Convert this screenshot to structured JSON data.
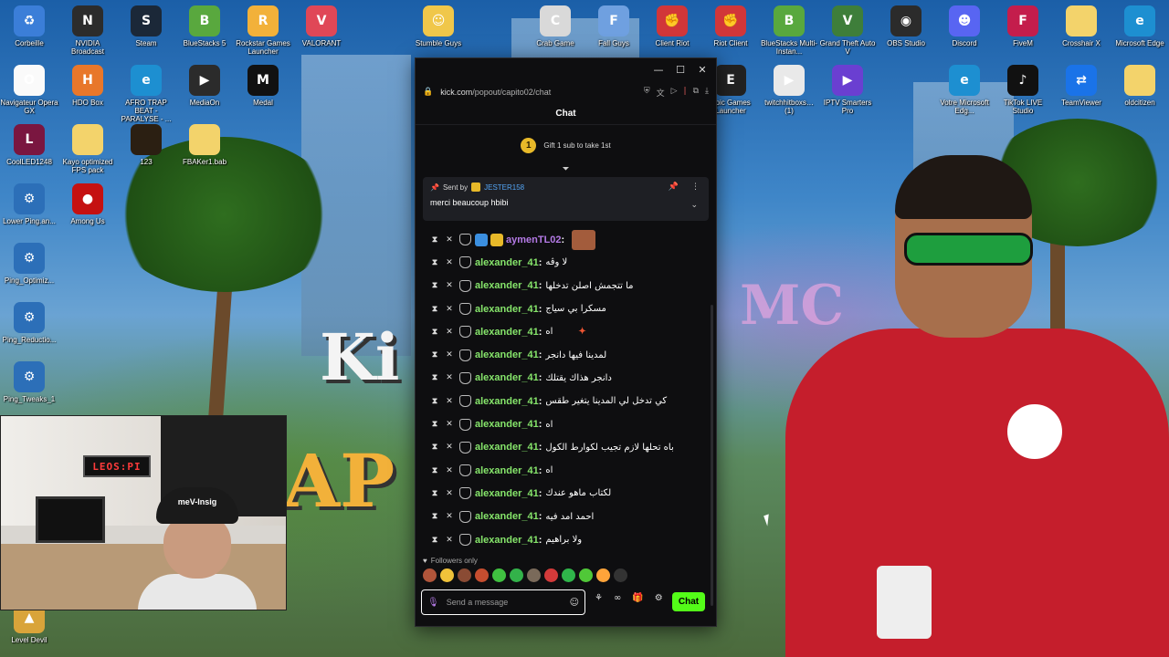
{
  "desktop": {
    "icons": [
      {
        "label": "Corbeille",
        "icon": "recycle-bin-icon",
        "color": "#3b7ed8",
        "glyph": "♻"
      },
      {
        "label": "NVIDIA Broadcast",
        "icon": "nvidia-broadcast-icon",
        "color": "#2c2c2c",
        "glyph": "N"
      },
      {
        "label": "Steam",
        "icon": "steam-icon",
        "color": "#1b2838",
        "glyph": "S"
      },
      {
        "label": "BlueStacks 5",
        "icon": "bluestacks-icon",
        "color": "#59a83e",
        "glyph": "B"
      },
      {
        "label": "Rockstar Games Launcher",
        "icon": "rockstar-icon",
        "color": "#f2b13a",
        "glyph": "R"
      },
      {
        "label": "VALORANT",
        "icon": "valorant-icon",
        "color": "#e04757",
        "glyph": "V"
      },
      {
        "label": "Stumble Guys",
        "icon": "stumble-guys-icon",
        "color": "#f0c74a",
        "glyph": "☺"
      },
      {
        "label": "Crab Game",
        "icon": "crab-game-icon",
        "color": "#d9d9d9",
        "glyph": "C"
      },
      {
        "label": "Fall Guys",
        "icon": "fall-guys-icon",
        "color": "#6fa0e0",
        "glyph": "F"
      },
      {
        "label": "Client Riot",
        "icon": "riot-client-icon",
        "color": "#d13639",
        "glyph": "✊"
      },
      {
        "label": "Riot Client",
        "icon": "riot-client-icon",
        "color": "#d13639",
        "glyph": "✊"
      },
      {
        "label": "BlueStacks Multi-Instan...",
        "icon": "bluestacks-multi-icon",
        "color": "#59a83e",
        "glyph": "B"
      },
      {
        "label": "Grand Theft Auto V",
        "icon": "gta-icon",
        "color": "#3e7e3a",
        "glyph": "V"
      },
      {
        "label": "OBS Studio",
        "icon": "obs-icon",
        "color": "#2b2b2b",
        "glyph": "◉"
      },
      {
        "label": "Discord",
        "icon": "discord-icon",
        "color": "#5865f2",
        "glyph": "☻"
      },
      {
        "label": "FiveM",
        "icon": "fivem-icon",
        "color": "#c41d4c",
        "glyph": "F"
      },
      {
        "label": "Crosshair X",
        "icon": "folder-icon",
        "color": "#f3d36b",
        "glyph": ""
      },
      {
        "label": "Microsoft Edge",
        "icon": "edge-icon",
        "color": "#1d8fd1",
        "glyph": "e"
      },
      {
        "label": "Navigateur Opera GX",
        "icon": "opera-icon",
        "color": "#fafafa",
        "glyph": "O"
      },
      {
        "label": "HDO Box",
        "icon": "hdo-box-icon",
        "color": "#e8772a",
        "glyph": "H"
      },
      {
        "label": "AFRO TRAP BEAT - PARALYSE - ...",
        "icon": "edge-icon",
        "color": "#1d8fd1",
        "glyph": "e"
      },
      {
        "label": "MediaOn",
        "icon": "media-icon",
        "color": "#2b2b2b",
        "glyph": "▶"
      },
      {
        "label": "Medal",
        "icon": "medal-icon",
        "color": "#111111",
        "glyph": "M"
      },
      {
        "label": "Epic Games Launcher",
        "icon": "epic-games-icon",
        "color": "#222222",
        "glyph": "E"
      },
      {
        "label": "twitchhitboxs… (1)",
        "icon": "video-file-icon",
        "color": "#e9e9e9",
        "glyph": "▶"
      },
      {
        "label": "IPTV Smarters Pro",
        "icon": "iptv-icon",
        "color": "#6a3fd1",
        "glyph": "▶"
      },
      {
        "label": "Votre Microsoft Edg...",
        "icon": "edge-icon",
        "color": "#1d8fd1",
        "glyph": "e"
      },
      {
        "label": "TikTok LIVE Studio",
        "icon": "tiktok-icon",
        "color": "#111111",
        "glyph": "♪"
      },
      {
        "label": "TeamViewer",
        "icon": "teamviewer-icon",
        "color": "#1a73e8",
        "glyph": "⇄"
      },
      {
        "label": "oldcitizen",
        "icon": "folder-icon",
        "color": "#f3d36b",
        "glyph": ""
      },
      {
        "label": "CoolLED1248",
        "icon": "coolled-icon",
        "color": "#7a1640",
        "glyph": "L"
      },
      {
        "label": "Kayo optimized FPS pack",
        "icon": "folder-icon",
        "color": "#f3d36b",
        "glyph": ""
      },
      {
        "label": "123",
        "icon": "folder-dark-icon",
        "color": "#2b1f12",
        "glyph": ""
      },
      {
        "label": "FBAKer1.bab",
        "icon": "folder-icon",
        "color": "#f3d36b",
        "glyph": ""
      },
      {
        "label": "Lower Ping.an...",
        "icon": "script-file-icon",
        "color": "#2c6fb8",
        "glyph": "⚙"
      },
      {
        "label": "Among Us",
        "icon": "among-us-icon",
        "color": "#c51111",
        "glyph": "●"
      },
      {
        "label": "Ping_Optimiz...",
        "icon": "script-file-icon",
        "color": "#2c6fb8",
        "glyph": "⚙"
      },
      {
        "label": "Ping_Reductio...",
        "icon": "script-file-icon",
        "color": "#2c6fb8",
        "glyph": "⚙"
      },
      {
        "label": "Ping_Tweaks_1",
        "icon": "script-file-icon",
        "color": "#2c6fb8",
        "glyph": "⚙"
      },
      {
        "label": "Level Devil",
        "icon": "level-devil-icon",
        "color": "#d9a43a",
        "glyph": "▲"
      }
    ],
    "bg_text_1": "Ki",
    "bg_text_2": "AP",
    "bg_text_3": "MC"
  },
  "webcam": {
    "led_text": "LEOS:PI",
    "cap_text": "meV-Insig"
  },
  "window": {
    "url_domain": "kick.com",
    "url_path": "/popout/capito02/chat",
    "chat_title": "Chat",
    "gift_count": "1",
    "gift_text": "Gift 1 sub to take 1st",
    "pinned": {
      "sent_by_label": "Sent by",
      "sender": "JESTER158",
      "message": "merci beaucoup hbibi"
    },
    "messages": [
      {
        "user": "aymenTL02",
        "text": "",
        "style": "purple",
        "extra": "avatar"
      },
      {
        "user": "alexander_41",
        "text": "لا وڨه"
      },
      {
        "user": "alexander_41",
        "text": "ما تتجمش اصلن تدخلها"
      },
      {
        "user": "alexander_41",
        "text": "مسكرا بي سياج"
      },
      {
        "user": "alexander_41",
        "text": "اه",
        "extra": "sparkle"
      },
      {
        "user": "alexander_41",
        "text": "لمدينا فيها دانجر"
      },
      {
        "user": "alexander_41",
        "text": "دانجر هذاك يقتلك"
      },
      {
        "user": "alexander_41",
        "text": "كي تدخل لي المدينا يتغير طقس"
      },
      {
        "user": "alexander_41",
        "text": "اه"
      },
      {
        "user": "alexander_41",
        "text": "باه تحلها لازم تجيب لكوارط الكول"
      },
      {
        "user": "alexander_41",
        "text": "اه"
      },
      {
        "user": "alexander_41",
        "text": "لكتاب ماهو عندك"
      },
      {
        "user": "alexander_41",
        "text": "احمد امد فيه"
      },
      {
        "user": "alexander_41",
        "text": "ولا براهيم"
      }
    ],
    "followers_only": "Followers only",
    "input_placeholder": "Send a message",
    "send_label": "Chat",
    "accent_color": "#53fc18"
  }
}
